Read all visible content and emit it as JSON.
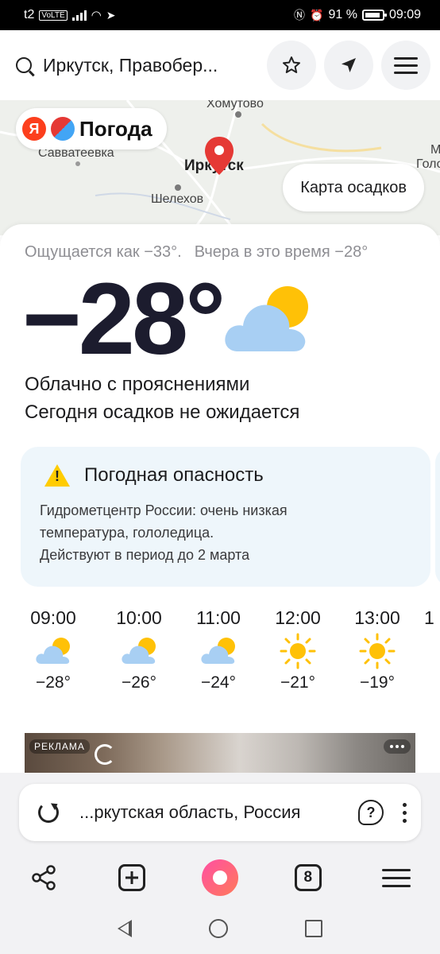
{
  "status_bar": {
    "carrier": "t2",
    "network_badge": "VoLTE",
    "battery_percent": "91 %",
    "battery_level": 0.91,
    "time": "09:09"
  },
  "search": {
    "query": "Иркутск, Правобер..."
  },
  "map": {
    "labels": {
      "khomutovo": "Хомутово",
      "savvateevka": "Савватеевка",
      "irkutsk": "Иркутск",
      "shelekhov": "Шелехов",
      "edge_m": "М",
      "edge_golo": "Голо"
    },
    "logo_letter": "Я",
    "logo_text": "Погода",
    "precip_button": "Карта осадков"
  },
  "current": {
    "feels_like": "Ощущается как −33°.",
    "yesterday": "Вчера в это время −28°",
    "temperature": "−28°",
    "condition": "Облачно с прояснениями",
    "precip_today": "Сегодня осадков не ожидается",
    "icon": "partly-cloudy-icon"
  },
  "alert": {
    "title": "Погодная опасность",
    "body_line1": "Гидрометцентр России: очень низкая",
    "body_line2": "температура, гололедица.",
    "body_line3": "Действуют в период до 2 марта"
  },
  "hourly": [
    {
      "time": "09:00",
      "icon": "partly-cloudy-icon",
      "temp": "−28°"
    },
    {
      "time": "10:00",
      "icon": "partly-cloudy-icon",
      "temp": "−26°"
    },
    {
      "time": "11:00",
      "icon": "partly-cloudy-icon",
      "temp": "−24°"
    },
    {
      "time": "12:00",
      "icon": "sun-icon",
      "temp": "−21°"
    },
    {
      "time": "13:00",
      "icon": "sun-icon",
      "temp": "−19°"
    }
  ],
  "hourly_peek_time": "1",
  "ad": {
    "label": "РЕКЛАМА"
  },
  "urlbar": {
    "text": "...ркутская область, Россия"
  },
  "toolbar": {
    "tabs_count": "8"
  },
  "colors": {
    "accent_yandex": "#fc3f1d",
    "alert_bg": "#eef6fb",
    "warning": "#ffcc00",
    "sun": "#ffc107",
    "cloud": "#9ec9f0",
    "pin": "#e53935"
  }
}
